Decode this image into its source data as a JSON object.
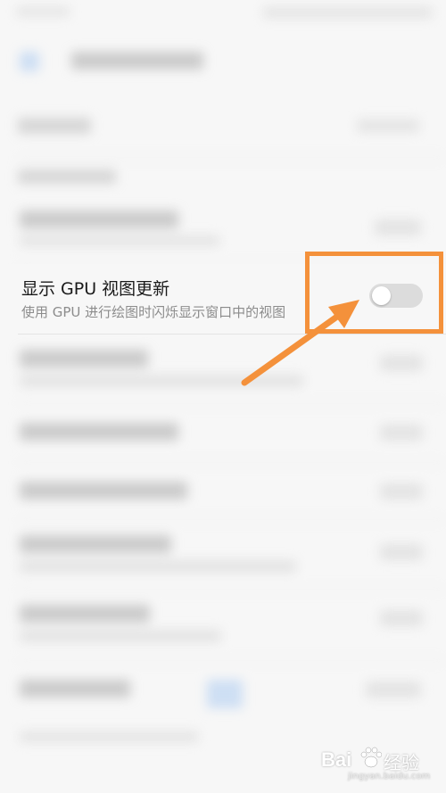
{
  "setting_row": {
    "title": "显示 GPU 视图更新",
    "subtitle": "使用 GPU 进行绘图时闪烁显示窗口中的视图",
    "toggle_on": false
  },
  "colors": {
    "highlight": "#f4913b",
    "toggle_track": "#dcdcdc",
    "toggle_knob": "#ffffff",
    "background": "#f7f7f7"
  },
  "icons": {
    "arrow": "arrow-up-right",
    "watermark": "baidu-paw"
  },
  "watermark": {
    "brand": "Bai",
    "product": "经验",
    "url": "jingyan.baidu.com"
  }
}
